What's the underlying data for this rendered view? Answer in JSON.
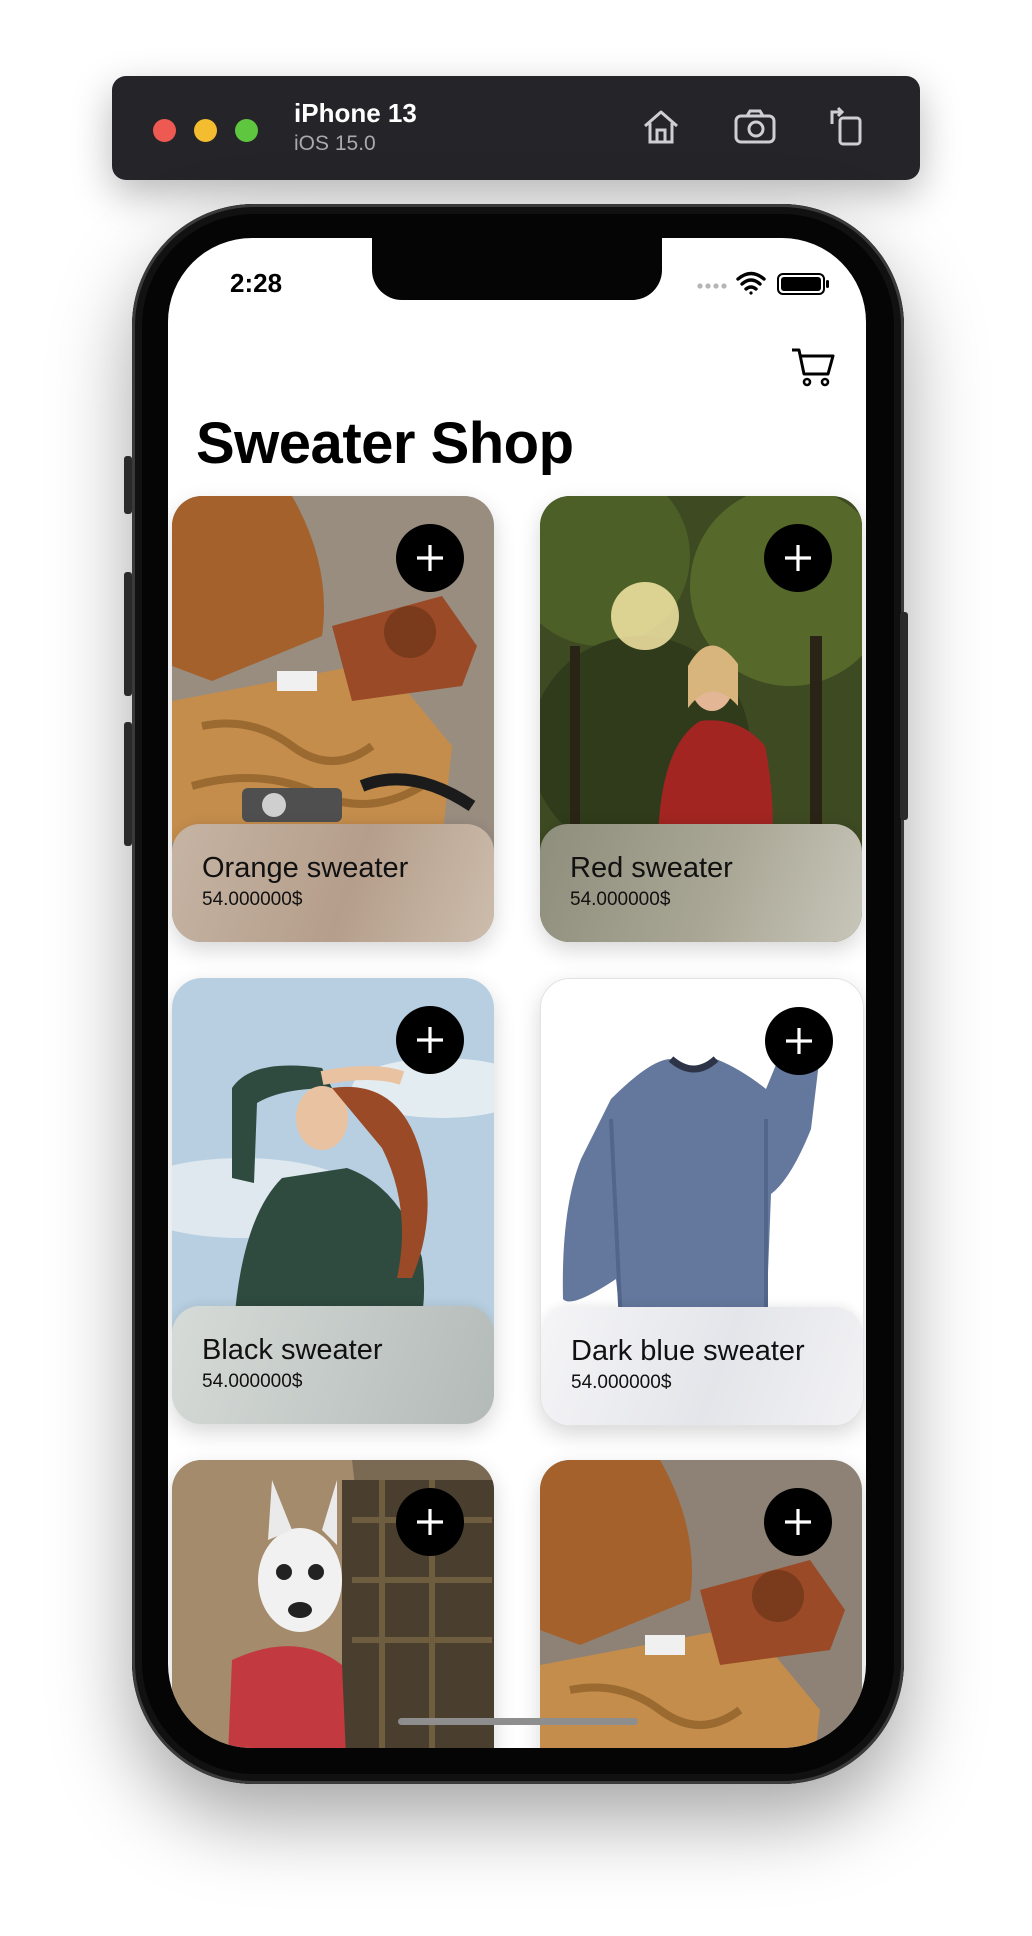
{
  "simulator": {
    "device_name": "iPhone 13",
    "os_version": "iOS 15.0",
    "toolbar_icons": [
      "home-icon",
      "screenshot-icon",
      "rotate-icon"
    ]
  },
  "status_bar": {
    "time": "2:28",
    "icons": [
      "signal-dots-icon",
      "wifi-icon",
      "battery-icon"
    ]
  },
  "header": {
    "title": "Sweater Shop",
    "cart_icon": "cart-icon"
  },
  "products": [
    {
      "name": "Orange sweater",
      "price": "54.000000$"
    },
    {
      "name": "Red sweater",
      "price": "54.000000$"
    },
    {
      "name": "Black sweater",
      "price": "54.000000$"
    },
    {
      "name": "Dark blue sweater",
      "price": "54.000000$"
    },
    {
      "name": "",
      "price": ""
    },
    {
      "name": "",
      "price": ""
    }
  ],
  "add_button_icon": "plus-icon",
  "colors": {
    "simulator_bar": "#252428",
    "button": "#000000",
    "title": "#000000"
  }
}
